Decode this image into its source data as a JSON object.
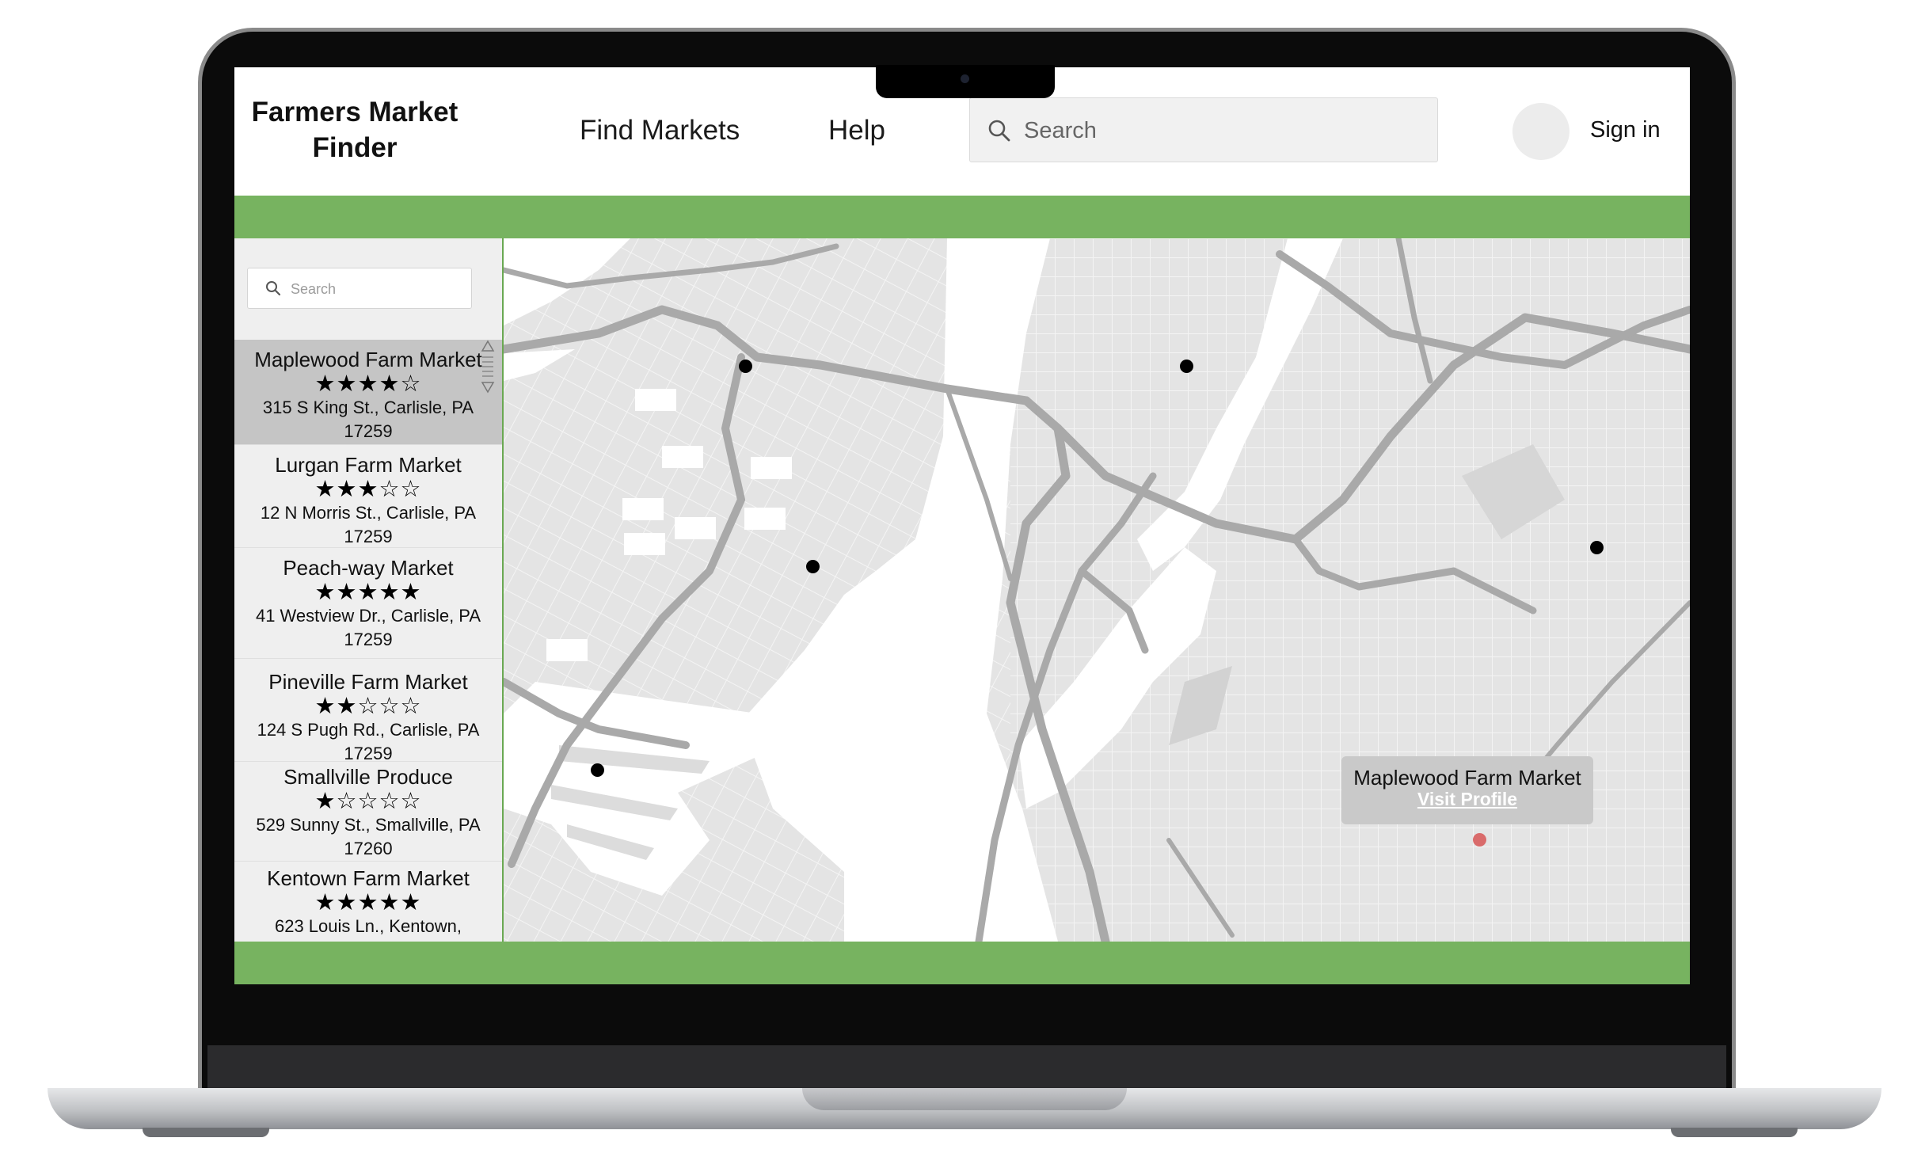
{
  "app": {
    "brand": "Farmers Market Finder"
  },
  "nav": {
    "find_markets": "Find Markets",
    "help": "Help",
    "search_placeholder": "Search",
    "sign_in": "Sign in"
  },
  "sidebar": {
    "search_placeholder": "Search",
    "markets": [
      {
        "name": "Maplewood Farm Market",
        "rating": 4,
        "stars": "★★★★☆",
        "address": "315 S King St., Carlisle, PA 17259",
        "selected": true
      },
      {
        "name": "Lurgan Farm Market",
        "rating": 3,
        "stars": "★★★☆☆",
        "address": "12 N Morris St., Carlisle, PA 17259",
        "selected": false
      },
      {
        "name": "Peach-way Market",
        "rating": 5,
        "stars": "★★★★★",
        "address": "41 Westview Dr., Carlisle, PA 17259",
        "selected": false
      },
      {
        "name": "Pineville Farm Market",
        "rating": 2,
        "stars": "★★☆☆☆",
        "address": "124 S Pugh Rd., Carlisle, PA 17259",
        "selected": false
      },
      {
        "name": "Smallville Produce",
        "rating": 1,
        "stars": "★☆☆☆☆",
        "address": "529 Sunny St., Smallville, PA 17260",
        "selected": false
      },
      {
        "name": "Kentown Farm Market",
        "rating": 5,
        "stars": "★★★★★",
        "address": "623 Louis Ln., Kentown,",
        "selected": false
      }
    ]
  },
  "map": {
    "popup": {
      "title": "Maplewood Farm Market",
      "link": "Visit Profile"
    },
    "colors": {
      "land": "#e4e4e4",
      "water": "#ffffff",
      "road": "#a9a9a9",
      "marker": "#000000",
      "active_marker": "#d96b6b"
    }
  },
  "theme": {
    "accent_green": "#77b360",
    "selected_row": "#c5c5c5"
  }
}
